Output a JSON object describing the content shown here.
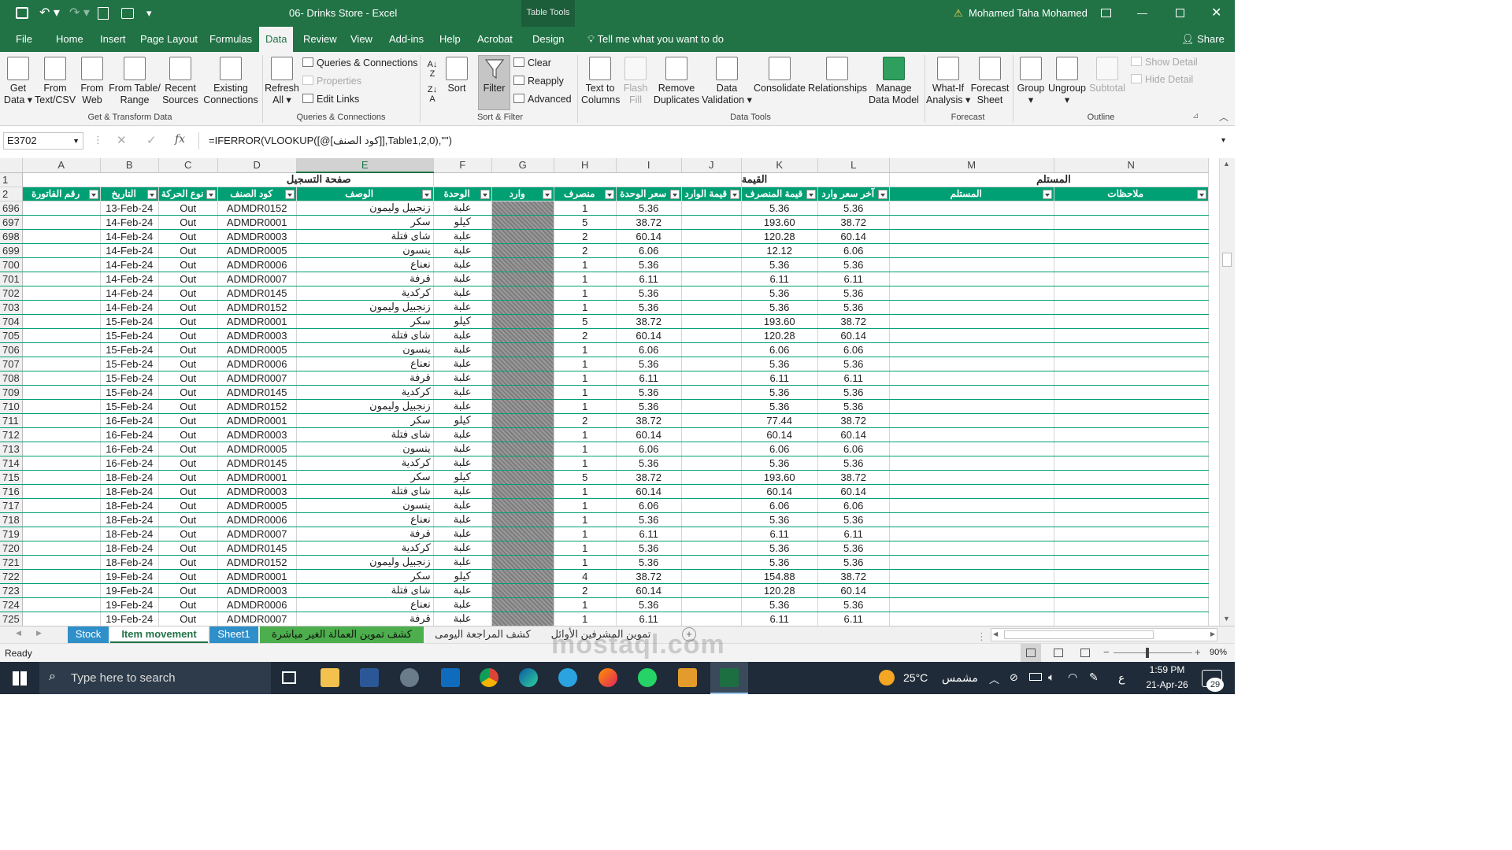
{
  "window": {
    "doc_title": "06- Drinks Store  -  Excel",
    "context_tab": "Table Tools",
    "user": "Mohamed Taha Mohamed",
    "accent": "#217346"
  },
  "tabs": [
    "File",
    "Home",
    "Insert",
    "Page Layout",
    "Formulas",
    "Data",
    "Review",
    "View",
    "Add-ins",
    "Help",
    "Acrobat",
    "Design"
  ],
  "active_tab": "Data",
  "tell_me": "Tell me what you want to do",
  "share": "Share",
  "ribbon": {
    "get_transform": {
      "label": "Get & Transform Data",
      "get_data": [
        "Get",
        "Data ▾"
      ],
      "from_text": [
        "From",
        "Text/CSV"
      ],
      "from_web": [
        "From",
        "Web"
      ],
      "from_table": [
        "From Table/",
        "Range"
      ],
      "recent": [
        "Recent",
        "Sources"
      ],
      "existing": [
        "Existing",
        "Connections"
      ]
    },
    "queries": {
      "label": "Queries & Connections",
      "refresh": [
        "Refresh",
        "All ▾"
      ],
      "qc": "Queries & Connections",
      "properties": "Properties",
      "edit_links": "Edit Links"
    },
    "sort_filter": {
      "label": "Sort & Filter",
      "sort": "Sort",
      "filter": "Filter",
      "clear": "Clear",
      "reapply": "Reapply",
      "advanced": "Advanced"
    },
    "data_tools": {
      "label": "Data Tools",
      "text_to_columns": [
        "Text to",
        "Columns"
      ],
      "flash_fill": [
        "Flash",
        "Fill"
      ],
      "remove_dup": [
        "Remove",
        "Duplicates"
      ],
      "validation": [
        "Data",
        "Validation ▾"
      ],
      "consolidate": "Consolidate",
      "relationships": "Relationships",
      "manage_model": [
        "Manage",
        "Data Model"
      ]
    },
    "forecast": {
      "label": "Forecast",
      "what_if": [
        "What-If",
        "Analysis ▾"
      ],
      "forecast_sheet": [
        "Forecast",
        "Sheet"
      ]
    },
    "outline": {
      "label": "Outline",
      "group": [
        "Group",
        "▾"
      ],
      "ungroup": [
        "Ungroup",
        "▾"
      ],
      "subtotal": "Subtotal",
      "show_detail": "Show Detail",
      "hide_detail": "Hide Detail"
    }
  },
  "formula_bar": {
    "name_box": "E3702",
    "fx": "fx",
    "formula": "=IFERROR(VLOOKUP([@[كود الصنف]],Table1,2,0),\"\")"
  },
  "columns": [
    "A",
    "B",
    "C",
    "D",
    "E",
    "F",
    "G",
    "H",
    "I",
    "J",
    "K",
    "L",
    "M",
    "N"
  ],
  "row1": {
    "e_title": "صفحة التسجيل",
    "value_title": "القيمة",
    "receiver_title": "المستلم"
  },
  "headers": [
    "رقم الفاتورة",
    "التاريخ",
    "نوع الحركة",
    "كود الصنف",
    "الوصف",
    "الوحدة",
    "وارد",
    "منصرف",
    "سعر الوحدة",
    "قيمة الوارد",
    "قيمة المنصرف",
    "آخر سعر وارد",
    "المستلم",
    "ملاحظات"
  ],
  "rows": [
    [
      "696",
      "13-Feb-24",
      "Out",
      "ADMDR0152",
      "زنجبيل وليمون",
      "علبة",
      "1",
      "5.36",
      "5.36",
      "5.36"
    ],
    [
      "697",
      "14-Feb-24",
      "Out",
      "ADMDR0001",
      "سكر",
      "كيلو",
      "5",
      "38.72",
      "193.60",
      "38.72"
    ],
    [
      "698",
      "14-Feb-24",
      "Out",
      "ADMDR0003",
      "شاى فتلة",
      "علبة",
      "2",
      "60.14",
      "120.28",
      "60.14"
    ],
    [
      "699",
      "14-Feb-24",
      "Out",
      "ADMDR0005",
      "ينسون",
      "علبة",
      "2",
      "6.06",
      "12.12",
      "6.06"
    ],
    [
      "700",
      "14-Feb-24",
      "Out",
      "ADMDR0006",
      "نعناع",
      "علبة",
      "1",
      "5.36",
      "5.36",
      "5.36"
    ],
    [
      "701",
      "14-Feb-24",
      "Out",
      "ADMDR0007",
      "قرفة",
      "علبة",
      "1",
      "6.11",
      "6.11",
      "6.11"
    ],
    [
      "702",
      "14-Feb-24",
      "Out",
      "ADMDR0145",
      "كركدية",
      "علبة",
      "1",
      "5.36",
      "5.36",
      "5.36"
    ],
    [
      "703",
      "14-Feb-24",
      "Out",
      "ADMDR0152",
      "زنجبيل وليمون",
      "علبة",
      "1",
      "5.36",
      "5.36",
      "5.36"
    ],
    [
      "704",
      "15-Feb-24",
      "Out",
      "ADMDR0001",
      "سكر",
      "كيلو",
      "5",
      "38.72",
      "193.60",
      "38.72"
    ],
    [
      "705",
      "15-Feb-24",
      "Out",
      "ADMDR0003",
      "شاى فتلة",
      "علبة",
      "2",
      "60.14",
      "120.28",
      "60.14"
    ],
    [
      "706",
      "15-Feb-24",
      "Out",
      "ADMDR0005",
      "ينسون",
      "علبة",
      "1",
      "6.06",
      "6.06",
      "6.06"
    ],
    [
      "707",
      "15-Feb-24",
      "Out",
      "ADMDR0006",
      "نعناع",
      "علبة",
      "1",
      "5.36",
      "5.36",
      "5.36"
    ],
    [
      "708",
      "15-Feb-24",
      "Out",
      "ADMDR0007",
      "قرفة",
      "علبة",
      "1",
      "6.11",
      "6.11",
      "6.11"
    ],
    [
      "709",
      "15-Feb-24",
      "Out",
      "ADMDR0145",
      "كركدية",
      "علبة",
      "1",
      "5.36",
      "5.36",
      "5.36"
    ],
    [
      "710",
      "15-Feb-24",
      "Out",
      "ADMDR0152",
      "زنجبيل وليمون",
      "علبة",
      "1",
      "5.36",
      "5.36",
      "5.36"
    ],
    [
      "711",
      "16-Feb-24",
      "Out",
      "ADMDR0001",
      "سكر",
      "كيلو",
      "2",
      "38.72",
      "77.44",
      "38.72"
    ],
    [
      "712",
      "16-Feb-24",
      "Out",
      "ADMDR0003",
      "شاى فتلة",
      "علبة",
      "1",
      "60.14",
      "60.14",
      "60.14"
    ],
    [
      "713",
      "16-Feb-24",
      "Out",
      "ADMDR0005",
      "ينسون",
      "علبة",
      "1",
      "6.06",
      "6.06",
      "6.06"
    ],
    [
      "714",
      "16-Feb-24",
      "Out",
      "ADMDR0145",
      "كركدية",
      "علبة",
      "1",
      "5.36",
      "5.36",
      "5.36"
    ],
    [
      "715",
      "18-Feb-24",
      "Out",
      "ADMDR0001",
      "سكر",
      "كيلو",
      "5",
      "38.72",
      "193.60",
      "38.72"
    ],
    [
      "716",
      "18-Feb-24",
      "Out",
      "ADMDR0003",
      "شاى فتلة",
      "علبة",
      "1",
      "60.14",
      "60.14",
      "60.14"
    ],
    [
      "717",
      "18-Feb-24",
      "Out",
      "ADMDR0005",
      "ينسون",
      "علبة",
      "1",
      "6.06",
      "6.06",
      "6.06"
    ],
    [
      "718",
      "18-Feb-24",
      "Out",
      "ADMDR0006",
      "نعناع",
      "علبة",
      "1",
      "5.36",
      "5.36",
      "5.36"
    ],
    [
      "719",
      "18-Feb-24",
      "Out",
      "ADMDR0007",
      "قرفة",
      "علبة",
      "1",
      "6.11",
      "6.11",
      "6.11"
    ],
    [
      "720",
      "18-Feb-24",
      "Out",
      "ADMDR0145",
      "كركدية",
      "علبة",
      "1",
      "5.36",
      "5.36",
      "5.36"
    ],
    [
      "721",
      "18-Feb-24",
      "Out",
      "ADMDR0152",
      "زنجبيل وليمون",
      "علبة",
      "1",
      "5.36",
      "5.36",
      "5.36"
    ],
    [
      "722",
      "19-Feb-24",
      "Out",
      "ADMDR0001",
      "سكر",
      "كيلو",
      "4",
      "38.72",
      "154.88",
      "38.72"
    ],
    [
      "723",
      "19-Feb-24",
      "Out",
      "ADMDR0003",
      "شاى فتلة",
      "علبة",
      "2",
      "60.14",
      "120.28",
      "60.14"
    ],
    [
      "724",
      "19-Feb-24",
      "Out",
      "ADMDR0006",
      "نعناع",
      "علبة",
      "1",
      "5.36",
      "5.36",
      "5.36"
    ],
    [
      "725",
      "19-Feb-24",
      "Out",
      "ADMDR0007",
      "قرفة",
      "علبة",
      "1",
      "6.11",
      "6.11",
      "6.11"
    ]
  ],
  "sheets": [
    {
      "name": "Stock",
      "bg": "#2e8fc9",
      "fg": "#ffffff"
    },
    {
      "name": "Item movement",
      "bg": "#ffffff",
      "fg": "#217346",
      "active": true
    },
    {
      "name": "Sheet1",
      "bg": "#2e8fc9",
      "fg": "#ffffff"
    },
    {
      "name": "كشف تموين العمالة الغير مباشرة",
      "bg": "#4cae4c",
      "fg": "#111111"
    },
    {
      "name": "كشف المراجعة اليومى",
      "bg": "#f0f0f0",
      "fg": "#333333"
    },
    {
      "name": "تموين المشرفين الأوائل",
      "bg": "#f0f0f0",
      "fg": "#333333"
    }
  ],
  "status": {
    "ready": "Ready",
    "zoom": "90%"
  },
  "taskbar": {
    "search": "Type here to search",
    "weather_temp": "25°C",
    "weather_text": "مشمس",
    "lang": "ع",
    "time": "1:59 PM",
    "date": "21-Apr-26",
    "badge": "29"
  },
  "watermark": "mostaql.com"
}
